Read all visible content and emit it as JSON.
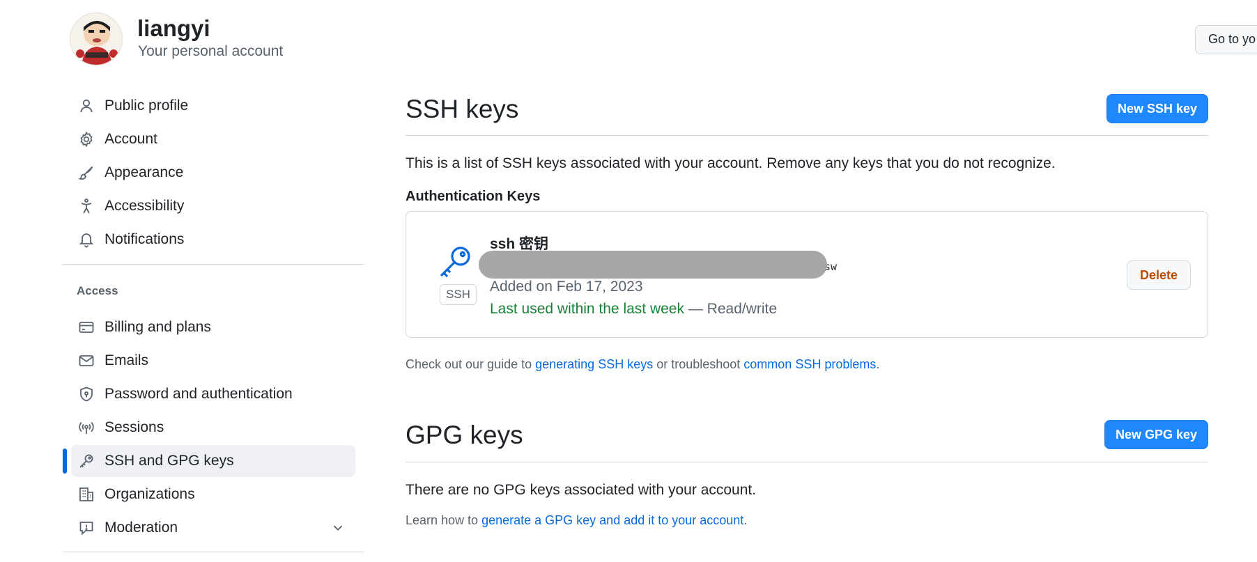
{
  "header": {
    "username": "liangyi",
    "subtitle": "Your personal account",
    "goto_button": "Go to yo"
  },
  "sidebar": {
    "items": [
      {
        "label": "Public profile",
        "icon": "person-icon"
      },
      {
        "label": "Account",
        "icon": "gear-icon"
      },
      {
        "label": "Appearance",
        "icon": "paintbrush-icon"
      },
      {
        "label": "Accessibility",
        "icon": "accessibility-icon"
      },
      {
        "label": "Notifications",
        "icon": "bell-icon"
      }
    ],
    "access_heading": "Access",
    "access_items": [
      {
        "label": "Billing and plans",
        "icon": "credit-card-icon"
      },
      {
        "label": "Emails",
        "icon": "mail-icon"
      },
      {
        "label": "Password and authentication",
        "icon": "shield-lock-icon"
      },
      {
        "label": "Sessions",
        "icon": "broadcast-icon"
      },
      {
        "label": "SSH and GPG keys",
        "icon": "key-icon",
        "active": true
      },
      {
        "label": "Organizations",
        "icon": "organization-icon"
      },
      {
        "label": "Moderation",
        "icon": "report-icon"
      }
    ]
  },
  "ssh": {
    "title": "SSH keys",
    "new_button": "New SSH key",
    "description": "This is a list of SSH keys associated with your account. Remove any keys that you do not recognize.",
    "auth_heading": "Authentication Keys",
    "key": {
      "badge": "SSH",
      "title": "ssh 密钥",
      "fingerprint_visible": "sw",
      "added": "Added on Feb 17, 2023",
      "last_used": "Last used within the last week",
      "access": " — Read/write",
      "delete_button": "Delete"
    },
    "guide_prefix": "Check out our guide to ",
    "guide_link1": "generating SSH keys",
    "guide_middle": " or troubleshoot ",
    "guide_link2": "common SSH problems",
    "guide_suffix": "."
  },
  "gpg": {
    "title": "GPG keys",
    "new_button": "New GPG key",
    "empty_text": "There are no GPG keys associated with your account.",
    "learn_prefix": "Learn how to ",
    "learn_link": "generate a GPG key and add it to your account",
    "learn_suffix": "."
  },
  "colors": {
    "primary": "#1f88fe",
    "link": "#0969da",
    "success": "#1a7f37",
    "danger": "#bc4c00"
  }
}
